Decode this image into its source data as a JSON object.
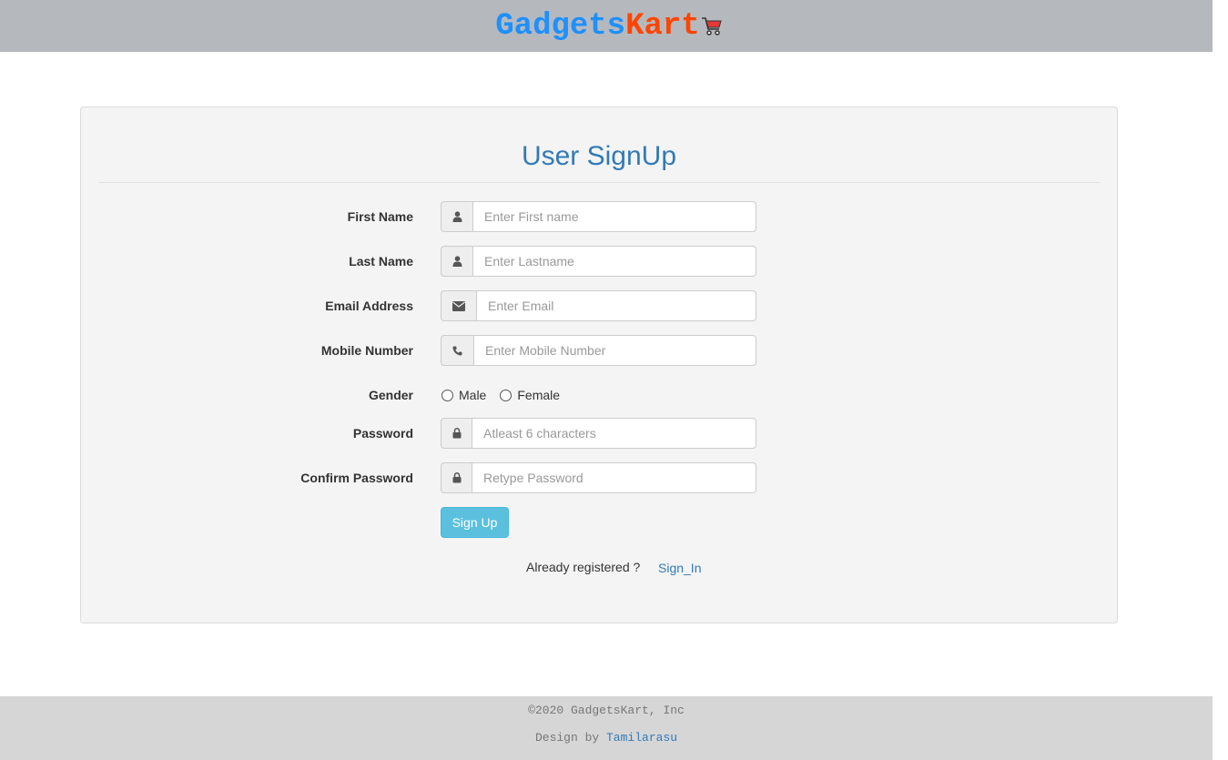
{
  "header": {
    "brand_part1": "Gadgets",
    "brand_part2": "Kart",
    "brand_color1": "#1e90ff",
    "brand_color2": "#ff4500",
    "cart_icon": "shopping-cart-icon"
  },
  "form": {
    "title": "User SignUp",
    "fields": {
      "first_name": {
        "label": "First Name",
        "placeholder": "Enter First name",
        "icon": "user-icon"
      },
      "last_name": {
        "label": "Last Name",
        "placeholder": "Enter Lastname",
        "icon": "user-icon"
      },
      "email": {
        "label": "Email Address",
        "placeholder": "Enter Email",
        "icon": "envelope-icon"
      },
      "mobile": {
        "label": "Mobile Number",
        "placeholder": "Enter Mobile Number",
        "icon": "phone-icon"
      },
      "gender": {
        "label": "Gender",
        "options": [
          "Male",
          "Female"
        ]
      },
      "password": {
        "label": "Password",
        "placeholder": "Atleast 6 characters",
        "icon": "lock-icon"
      },
      "confirm_password": {
        "label": "Confirm Password",
        "placeholder": "Retype Password",
        "icon": "lock-icon"
      }
    },
    "submit_label": "Sign Up",
    "already_registered": "Already registered ?",
    "signin_link": "Sign_In",
    "accent_color": "#337ab7",
    "button_color": "#5bc0de"
  },
  "footer": {
    "copyright": "©2020 GadgetsKart, Inc",
    "design_by": "Design by",
    "designer": "Tamilarasu"
  }
}
